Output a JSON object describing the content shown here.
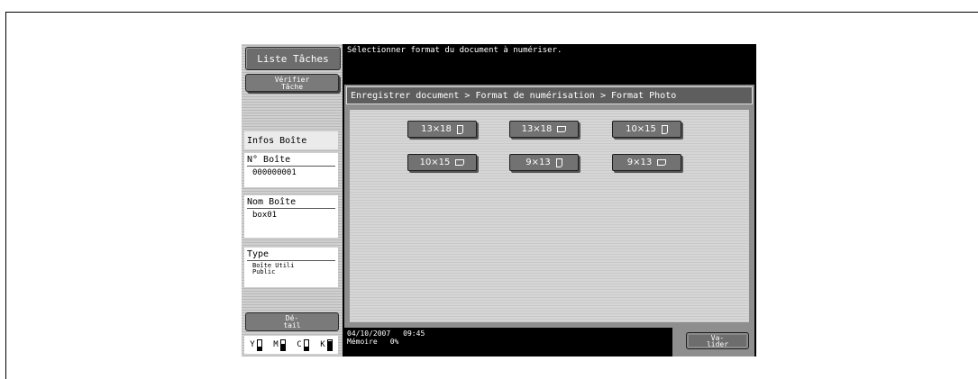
{
  "left_panel": {
    "job_list_label": "Liste Tâches",
    "verify_job_label": "Vérifier\nTâche",
    "box_info_title": "Infos Boîte",
    "box_number_label": "N° Boîte",
    "box_number_value": "000000001",
    "box_name_label": "Nom Boîte",
    "box_name_value": "box01",
    "type_label": "Type",
    "type_value": "Boîte Utili\nPublic",
    "detail_label": "Dé-\ntail",
    "toner": [
      {
        "letter": "Y",
        "level": 0.3
      },
      {
        "letter": "M",
        "level": 0.6
      },
      {
        "letter": "C",
        "level": 0.3
      },
      {
        "letter": "K",
        "level": 0.85
      }
    ]
  },
  "header": {
    "message": "Sélectionner format du document à numériser."
  },
  "breadcrumb": "Enregistrer document > Format de numérisation  > Format Photo",
  "formats": [
    {
      "label": "13×18",
      "orientation": "portrait"
    },
    {
      "label": "13×18",
      "orientation": "landscape"
    },
    {
      "label": "10×15",
      "orientation": "portrait"
    },
    {
      "label": "10×15",
      "orientation": "landscape"
    },
    {
      "label": "9×13",
      "orientation": "portrait"
    },
    {
      "label": "9×13",
      "orientation": "landscape"
    }
  ],
  "status": {
    "date": "04/10/2007",
    "time": "09:45",
    "memory_label": "Mémoire",
    "memory_value": "0%"
  },
  "validate_label": "Va-\nlider"
}
